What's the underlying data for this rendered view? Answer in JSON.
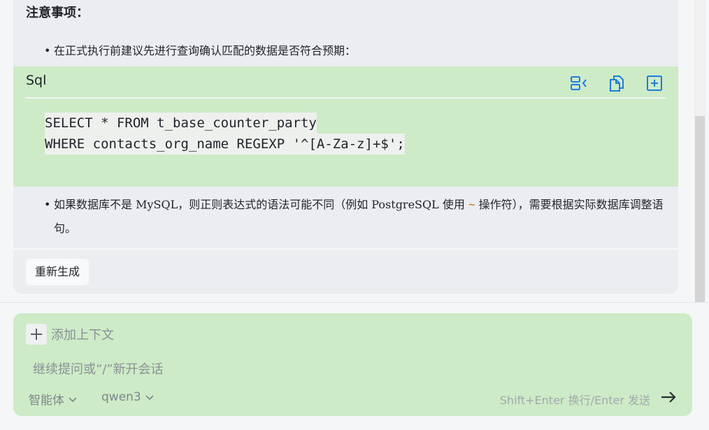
{
  "answer": {
    "heading": "注意事项：",
    "bullet1": "在正式执行前建议先进行查询确认匹配的数据是否符合预期：",
    "code": {
      "language": "Sql",
      "lines": [
        "SELECT * FROM t_base_counter_party",
        "WHERE contacts_org_name REGEXP '^[A-Za-z]+$';"
      ],
      "tools": [
        "wrap-icon",
        "copy-icon",
        "insert-icon"
      ]
    },
    "bullet2": {
      "before": "如果数据库不是 MySQL，则正则表达式的语法可能不同（例如 PostgreSQL 使用 ",
      "code": "~",
      "after": " 操作符），需要根据实际数据库调整语句。"
    },
    "regenerate_label": "重新生成"
  },
  "composer": {
    "add_context_label": "添加上下文",
    "placeholder": "继续提问或“/”新开会话",
    "agent_label": "智能体",
    "model_label": "qwen3",
    "hint": "Shift+Enter 换行/Enter 发送"
  },
  "colors": {
    "code_bg": "#cdebc7",
    "icon_blue": "#1e7be0",
    "inline_code": "#c2761c"
  }
}
